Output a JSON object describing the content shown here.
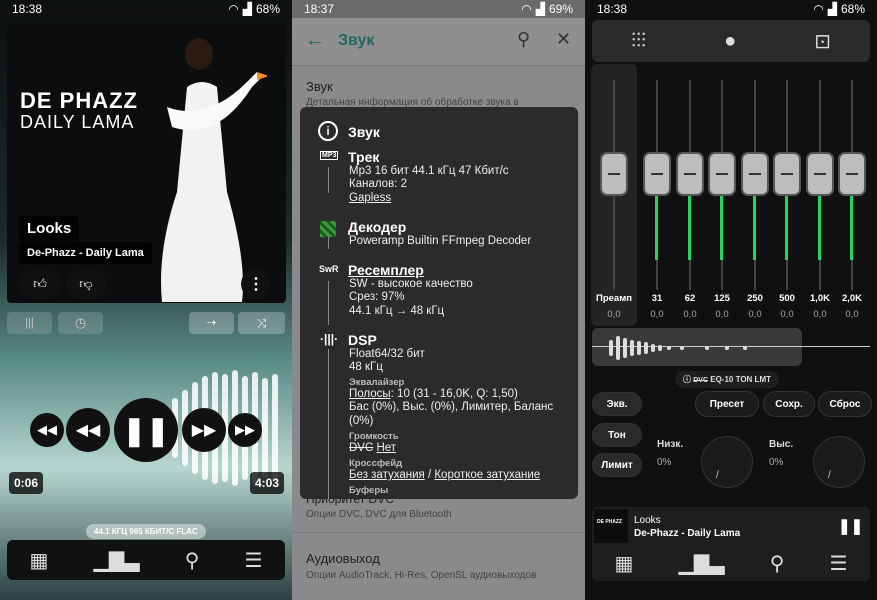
{
  "panel1": {
    "time": "18:38",
    "battery": "68%",
    "track_title": "Looks",
    "artist_album": "De-Phazz - Daily Lama",
    "elapsed": "0:06",
    "duration": "4:03",
    "format_info": "44.1 КГЦ 965 КБИТ/С FLAC",
    "album_art_line1": "DE PHAZZ",
    "album_art_line2": "DAILY LAMA"
  },
  "panel2": {
    "time": "18:37",
    "battery": "69%",
    "title": "Звук",
    "bg_item1_title": "Звук",
    "bg_item1_sub": "Детальная информация об обработке звука в",
    "bg_item2_title": "Приоритет DVC",
    "bg_item2_sub": "Опции DVC, DVC для Bluetooth",
    "bg_item3_title": "Аудиовыход",
    "bg_item3_sub": "Опции AudioTrack, Hi-Res, OpenSL аудиовыходов",
    "dialog": {
      "title": "Звук",
      "track_head": "Трек",
      "track_l1": "Mp3 16 бит 44.1 кГц 47 Кбит/с",
      "track_l2": "Каналов: 2",
      "track_l3": "Gapless",
      "decoder_head": "Декодер",
      "decoder_l1": "Poweramp Builtin FFmpeg Decoder",
      "resampler_head": "Ресемплер",
      "res_l1": "SW - высокое качество",
      "res_l2": "Срез: 97%",
      "res_l3": "44.1 кГц → 48 кГц",
      "dsp_head": "DSP",
      "dsp_l1": "Float64/32 бит",
      "dsp_l2": "48 кГц",
      "eq_sub": "Эквалайзер",
      "eq_l1a": "Полосы",
      "eq_l1b": ": 10 (31 - 16,0K, Q: 1,50)",
      "eq_l2": "Бас (0%), Выс. (0%), Лимитер, Баланс",
      "eq_l3": "(0%)",
      "vol_sub": "Громкость",
      "vol_dvc": "DVC",
      "vol_no": "Нет",
      "cf_sub": "Кроссфейд",
      "cf_a": "Без затухания",
      "cf_sep": " / ",
      "cf_b": "Короткое затухание",
      "buf_sub": "Буферы",
      "ic_mp3": "MP3",
      "ic_swr": "SwR"
    }
  },
  "panel3": {
    "time": "18:38",
    "battery": "68%",
    "bands": [
      {
        "label": "Преамп",
        "value": "0,0"
      },
      {
        "label": "31",
        "value": "0,0"
      },
      {
        "label": "62",
        "value": "0,0"
      },
      {
        "label": "125",
        "value": "0,0"
      },
      {
        "label": "250",
        "value": "0,0"
      },
      {
        "label": "500",
        "value": "0,0"
      },
      {
        "label": "1,0K",
        "value": "0,0"
      },
      {
        "label": "2,0K",
        "value": "0,0"
      }
    ],
    "preset_name": "EQ-10 TON LMT",
    "dvc_tag": "DVC",
    "btn_eq": "Экв.",
    "btn_tone": "Тон",
    "btn_limit": "Лимит",
    "btn_preset": "Пресет",
    "btn_save": "Сохр.",
    "btn_reset": "Сброс",
    "bass_label": "Низк.",
    "bass_value": "0%",
    "treble_label": "Выс.",
    "treble_value": "0%",
    "mini_title": "Looks",
    "mini_artist": "De-Phazz - Daily Lama"
  }
}
